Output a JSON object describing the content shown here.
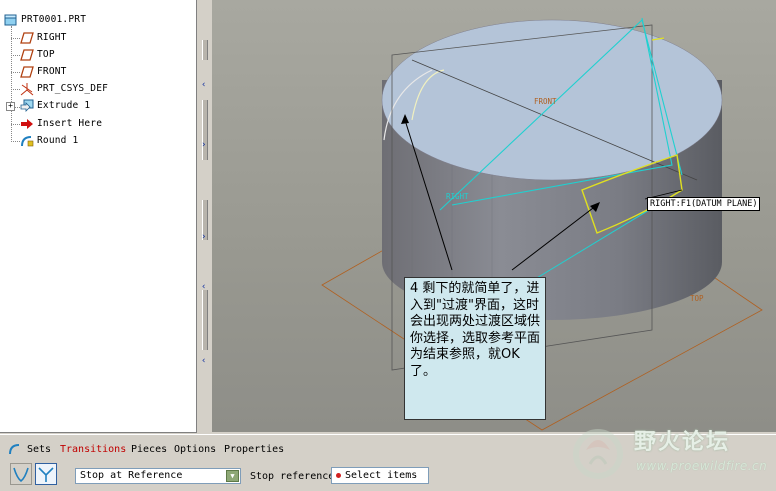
{
  "model_tree": {
    "items": [
      {
        "label": "PRT0001.PRT",
        "icon": "part-icon"
      },
      {
        "label": "RIGHT",
        "icon": "datum-plane-icon"
      },
      {
        "label": "TOP",
        "icon": "datum-plane-icon"
      },
      {
        "label": "FRONT",
        "icon": "datum-plane-icon"
      },
      {
        "label": "PRT_CSYS_DEF",
        "icon": "coordinate-system-icon"
      },
      {
        "label": "Extrude 1",
        "icon": "extrude-icon",
        "expander": "+"
      },
      {
        "label": "Insert Here",
        "icon": "insert-here-arrow-icon"
      },
      {
        "label": "Round 1",
        "icon": "round-icon"
      }
    ]
  },
  "viewport": {
    "datum_labels": {
      "front": "FRONT",
      "top": "TOP",
      "right": "RIGHT"
    },
    "selection_tag": "RIGHT:F1(DATUM PLANE)",
    "callout": "4 剩下的就简单了，进入到\"过渡\"界面，这时会出现两处过渡区域供你选择，选取参考平面为结束参照，就OK了。"
  },
  "dashboard": {
    "tabs": {
      "sets": "Sets",
      "transitions": "Transitions",
      "pieces": "Pieces",
      "options": "Options",
      "properties": "Properties"
    },
    "transition_type": "Stop at Reference",
    "stop_reference_label": "Stop reference",
    "collector": "Select items"
  },
  "watermark": {
    "title": "野火论坛",
    "url": "www.proewildfire.cn"
  },
  "colors": {
    "tab_active": "#c00000",
    "callout_bg": "#cfe8ee",
    "datum_plane": "#b06020",
    "cyan_edge": "#20d0d0",
    "highlight": "#e0e020"
  }
}
